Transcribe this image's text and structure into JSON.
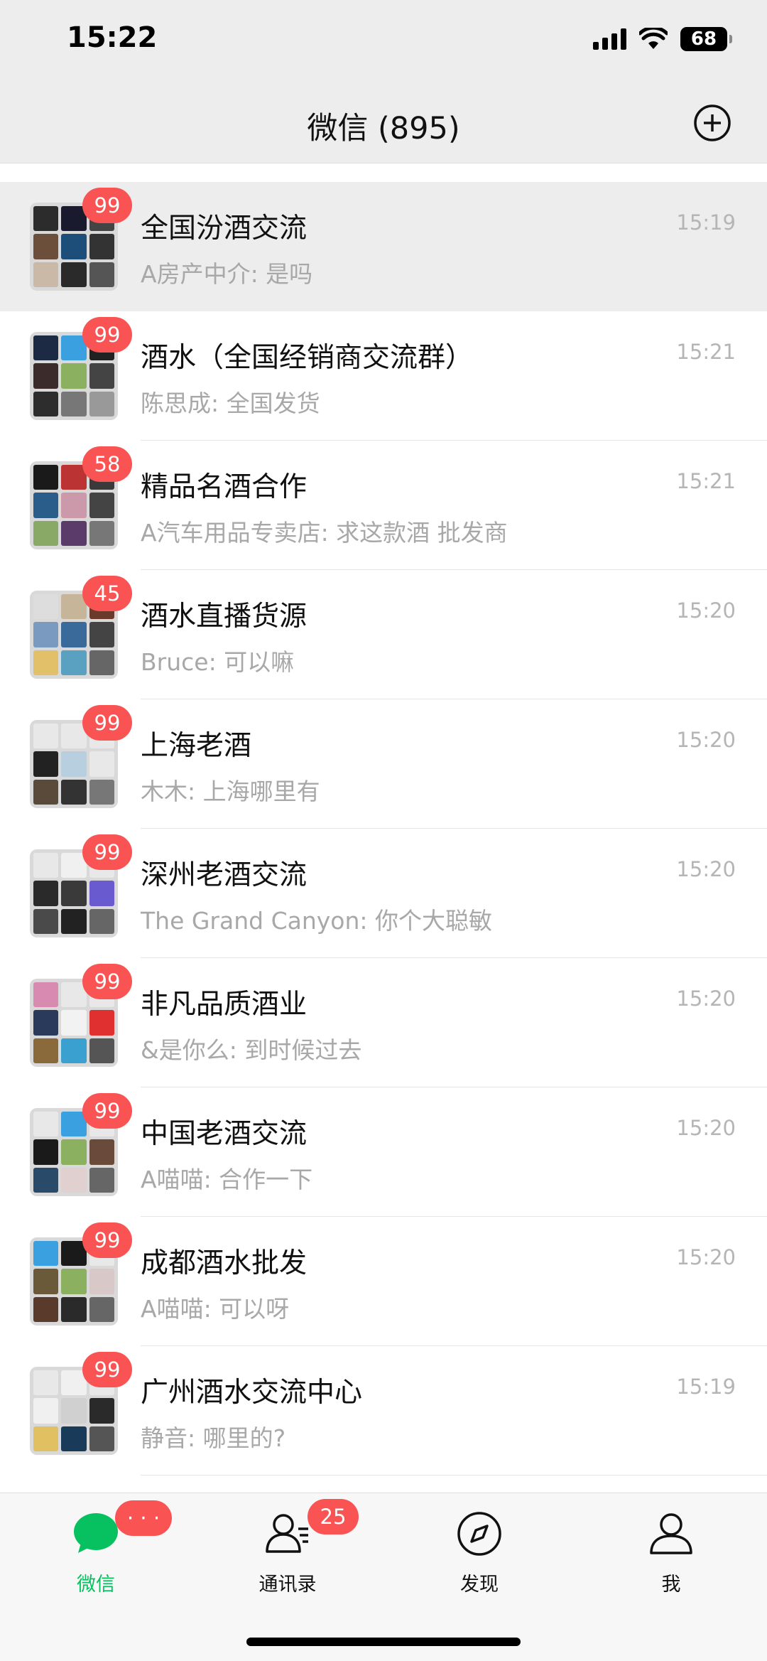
{
  "status_bar": {
    "time": "15:22",
    "battery": "68"
  },
  "nav": {
    "title": "微信 (895)",
    "add_icon": "plus-circle-icon"
  },
  "chats": [
    {
      "name": "全国汾酒交流",
      "preview": "A房产中介: 是吗",
      "time": "15:19",
      "badge": "99",
      "pinned": true
    },
    {
      "name": "酒水（全国经销商交流群）",
      "preview": "陈思成: 全国发货",
      "time": "15:21",
      "badge": "99"
    },
    {
      "name": "精品名酒合作",
      "preview": "A汽车用品专卖店: 求这款酒 批发商",
      "time": "15:21",
      "badge": "58"
    },
    {
      "name": "酒水直播货源",
      "preview": "Bruce: 可以嘛",
      "time": "15:20",
      "badge": "45"
    },
    {
      "name": "上海老酒",
      "preview": "木木: 上海哪里有",
      "time": "15:20",
      "badge": "99"
    },
    {
      "name": "深州老酒交流",
      "preview": "The Grand Canyon: 你个大聪敏",
      "time": "15:20",
      "badge": "99"
    },
    {
      "name": "非凡品质酒业",
      "preview": "&是你么: 到时候过去",
      "time": "15:20",
      "badge": "99"
    },
    {
      "name": "中国老酒交流",
      "preview": "A喵喵: 合作一下",
      "time": "15:20",
      "badge": "99"
    },
    {
      "name": "成都酒水批发",
      "preview": "A喵喵: 可以呀",
      "time": "15:20",
      "badge": "99"
    },
    {
      "name": "广州酒水交流中心",
      "preview": "静音: 哪里的?",
      "time": "15:19",
      "badge": "99"
    }
  ],
  "tabs": {
    "chats": {
      "label": "微信",
      "badge": "· · ·",
      "icon": "chat-bubble-icon"
    },
    "contacts": {
      "label": "通讯录",
      "badge": "25",
      "icon": "contacts-icon"
    },
    "discover": {
      "label": "发现",
      "icon": "compass-icon"
    },
    "me": {
      "label": "我",
      "icon": "person-icon"
    }
  },
  "colors": {
    "accent": "#07c160",
    "badge": "#f95353",
    "header_bg": "#ededed"
  }
}
